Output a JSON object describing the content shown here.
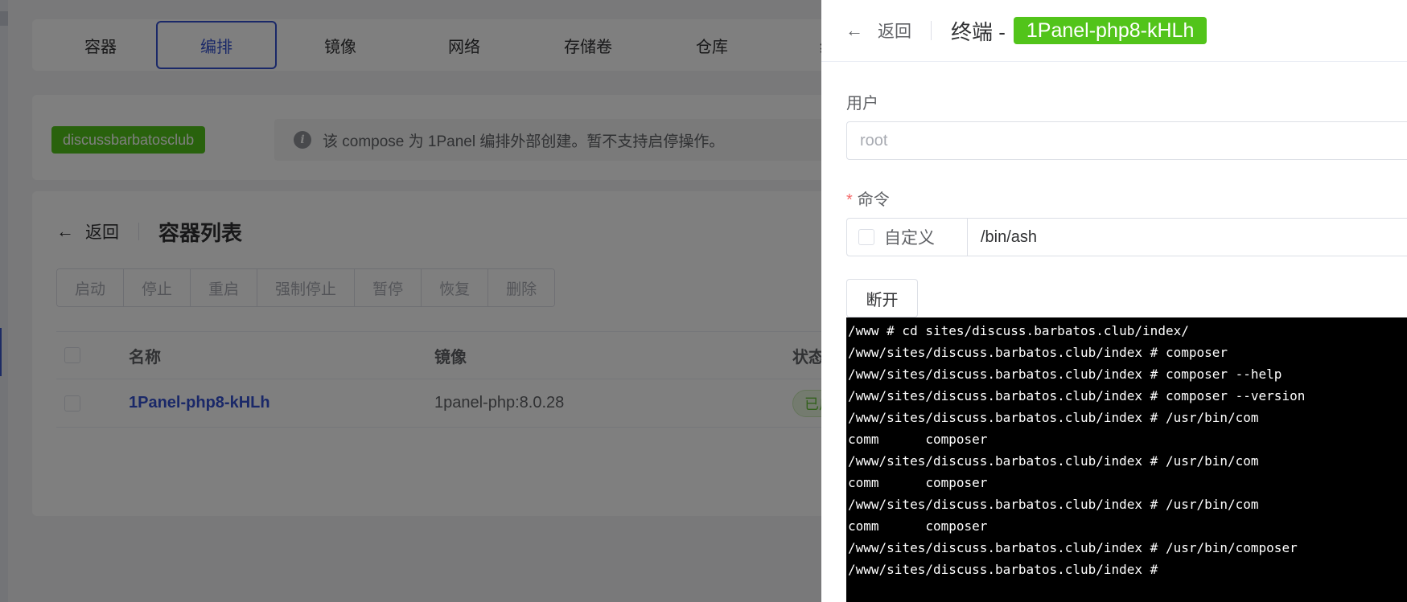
{
  "tabs": [
    "容器",
    "编排",
    "镜像",
    "网络",
    "存储卷",
    "仓库",
    "编排"
  ],
  "compose": {
    "tag": "discussbarbatosclub",
    "notice": "该 compose 为 1Panel 编排外部创建。暂不支持启停操作。"
  },
  "list": {
    "back_label": "返回",
    "title": "容器列表",
    "actions": [
      "启动",
      "停止",
      "重启",
      "强制停止",
      "暂停",
      "恢复",
      "删除"
    ],
    "columns": {
      "name": "名称",
      "image": "镜像",
      "status": "状态"
    },
    "rows": [
      {
        "name": "1Panel-php8-kHLh",
        "image": "1panel-php:8.0.28",
        "status": "已启"
      }
    ]
  },
  "drawer": {
    "back_label": "返回",
    "title_prefix": "终端 -",
    "container_name": "1Panel-php8-kHLh",
    "user_label": "用户",
    "user_placeholder": "root",
    "command_label": "命令",
    "custom_label": "自定义",
    "command_value": "/bin/ash",
    "disconnect_label": "断开"
  },
  "terminal": {
    "lines": [
      "/www # cd sites/discuss.barbatos.club/index/",
      "/www/sites/discuss.barbatos.club/index # composer",
      "/www/sites/discuss.barbatos.club/index # composer --help",
      "/www/sites/discuss.barbatos.club/index # composer --version",
      "/www/sites/discuss.barbatos.club/index # /usr/bin/com",
      "comm      composer",
      "/www/sites/discuss.barbatos.club/index # /usr/bin/com",
      "comm      composer",
      "/www/sites/discuss.barbatos.club/index # /usr/bin/com",
      "comm      composer",
      "/www/sites/discuss.barbatos.club/index # /usr/bin/composer",
      "/www/sites/discuss.barbatos.club/index #"
    ]
  },
  "colors": {
    "accent": "#3451d1",
    "success": "#52c41a",
    "terminal_bg": "#000000"
  }
}
